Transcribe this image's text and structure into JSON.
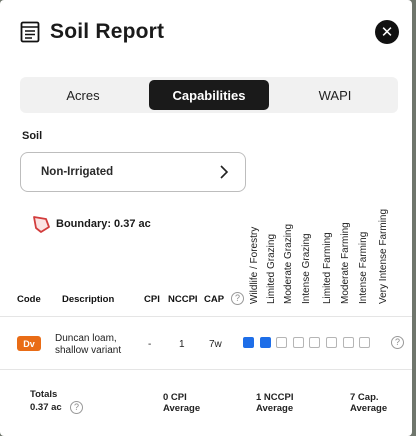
{
  "header": {
    "title": "Soil Report",
    "close_icon": "close-icon",
    "title_icon": "report-document-icon"
  },
  "tabs": [
    {
      "label": "Acres",
      "active": false
    },
    {
      "label": "Capabilities",
      "active": true
    },
    {
      "label": "WAPI",
      "active": false
    }
  ],
  "soil": {
    "label": "Soil",
    "selected": "Non-Irrigated"
  },
  "boundary": {
    "text": "Boundary: 0.37 ac"
  },
  "columns": {
    "code": "Code",
    "description": "Description",
    "cpi": "CPI",
    "nccpi": "NCCPI",
    "cap": "CAP",
    "capabilities": [
      "Wildlife / Forestry",
      "Limited Grazing",
      "Moderate Grazing",
      "Intense Grazing",
      "Limited Farming",
      "Moderate Farming",
      "Intense Farming",
      "Very Intense Farming"
    ]
  },
  "rows": [
    {
      "code": "Dv",
      "description_line1": "Duncan loam,",
      "description_line2": "shallow variant",
      "cpi": "-",
      "nccpi": "1",
      "cap": "7w",
      "capabilities_on": [
        true,
        true,
        false,
        false,
        false,
        false,
        false,
        false
      ]
    }
  ],
  "totals": {
    "label": "Totals",
    "acres": "0.37 ac",
    "cpi_value": "0 CPI",
    "cpi_sub": "Average",
    "nccpi_value": "1 NCCPI",
    "nccpi_sub": "Average",
    "cap_value": "7 Cap.",
    "cap_sub": "Average"
  },
  "colors": {
    "accent": "#1e6ee8",
    "badge": "#e96c16",
    "dark": "#1a1a1a"
  }
}
